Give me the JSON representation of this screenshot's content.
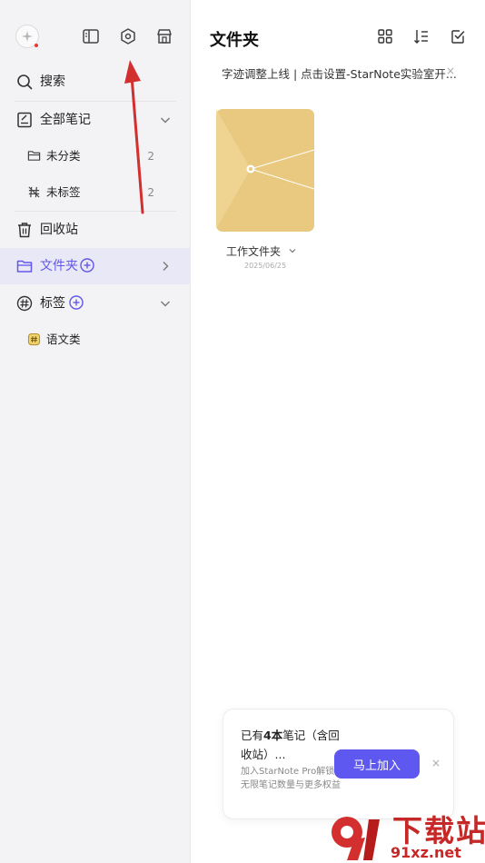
{
  "sidebar": {
    "search_label": "搜索",
    "all_notes_label": "全部笔记",
    "uncategorized_label": "未分类",
    "uncategorized_count": "2",
    "untagged_label": "未标签",
    "untagged_count": "2",
    "trash_label": "回收站",
    "folders_label": "文件夹",
    "tags_label": "标签",
    "tag_items": [
      "语文类"
    ]
  },
  "main": {
    "title": "文件夹",
    "notice": "字迹调整上线 | 点击设置-StarNote实验室开...",
    "notice_close": "×",
    "folder": {
      "name": "工作文件夹",
      "date": "2025/06/25"
    }
  },
  "promo": {
    "title_prefix": "已有",
    "title_bold": "4本",
    "title_suffix": "笔记（含回收站）...",
    "desc": "加入StarNote Pro解锁无限笔记数量与更多权益",
    "button_label": "马上加入",
    "close": "×"
  },
  "watermark": {
    "top": "下载站",
    "bottom": "91xz.net"
  },
  "colors": {
    "accent": "#5e57f0",
    "folder": "#e9c97f",
    "annotation_arrow": "#d32f2f"
  }
}
